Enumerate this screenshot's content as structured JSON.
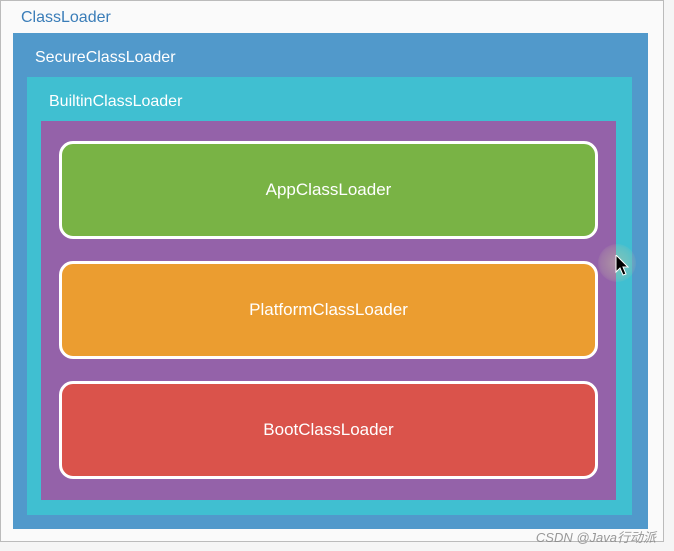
{
  "outer": {
    "title": "ClassLoader"
  },
  "secure": {
    "title": "SecureClassLoader"
  },
  "builtin": {
    "title": "BuiltinClassLoader"
  },
  "loaders": {
    "app": "AppClassLoader",
    "platform": "PlatformClassLoader",
    "boot": "BootClassLoader"
  },
  "watermark": "CSDN @Java行动派",
  "colors": {
    "outer_box": "#5199cb",
    "secure_box": "#40bfd1",
    "builtin_box": "#9462a9",
    "app_loader": "#79b345",
    "platform_loader": "#eb9d30",
    "boot_loader": "#da534b"
  }
}
